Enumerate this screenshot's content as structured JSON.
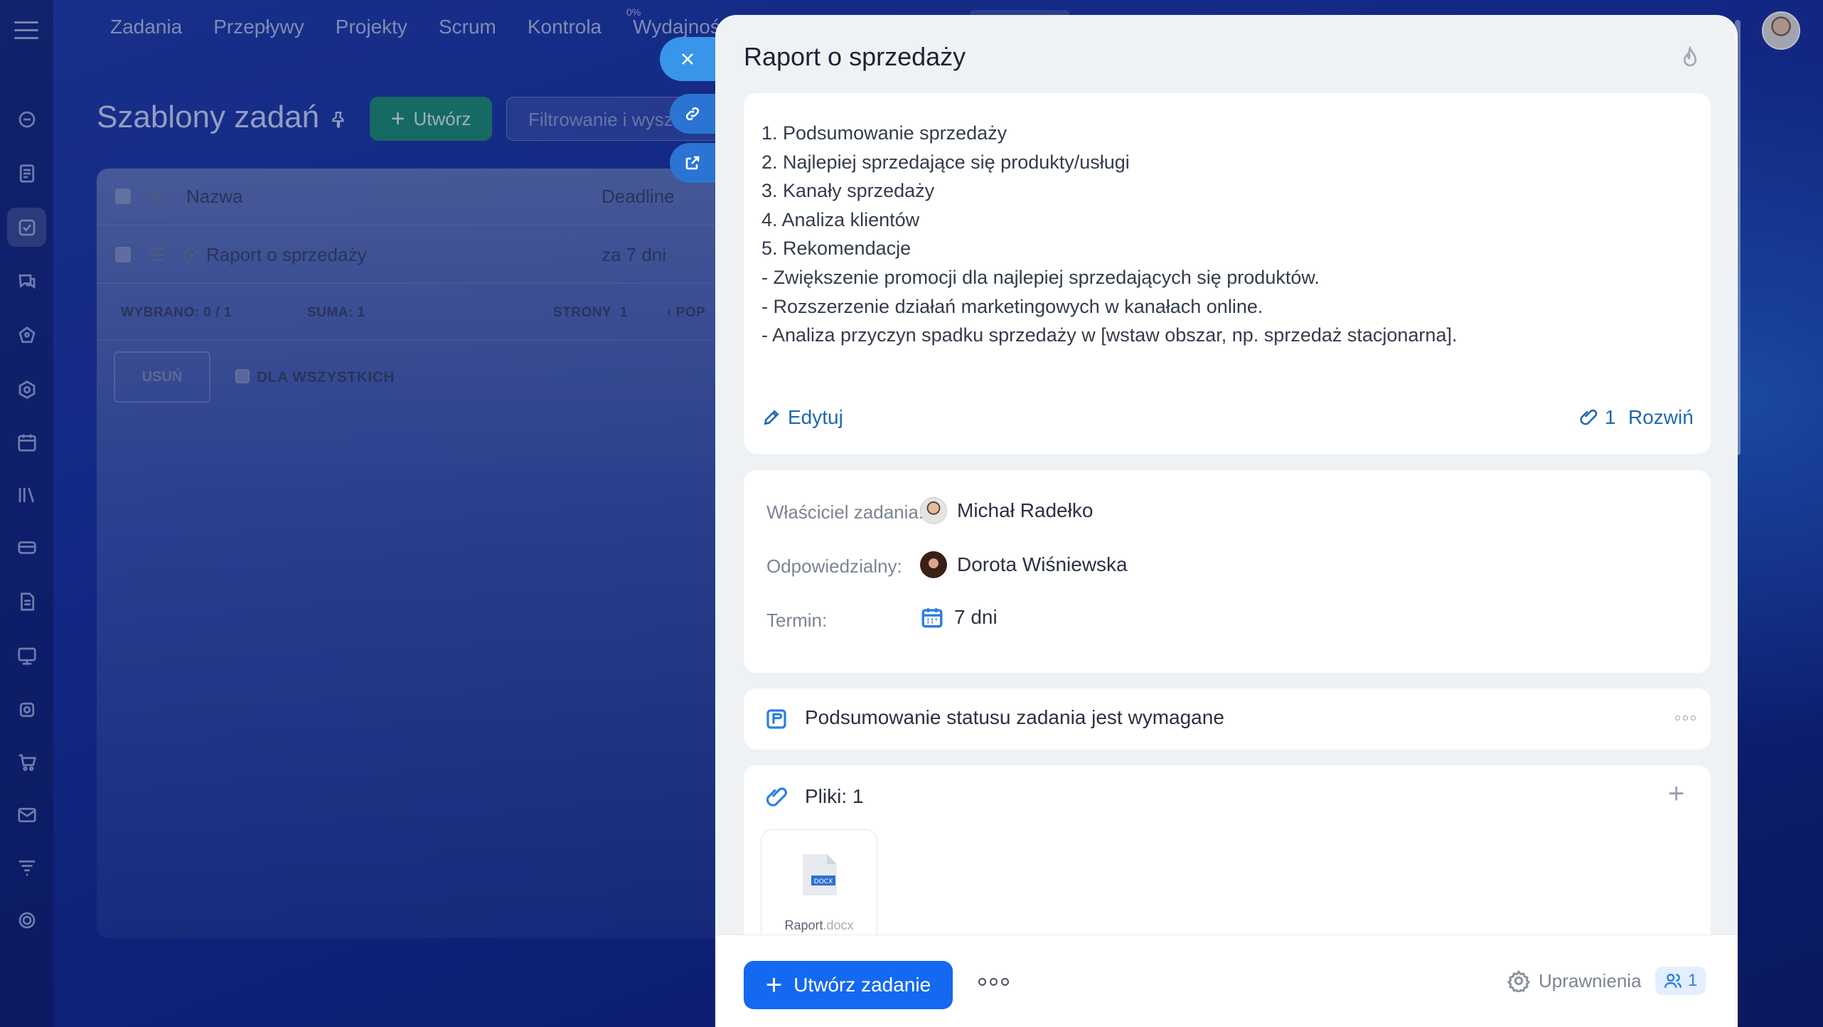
{
  "background": {
    "topnav": [
      "Zadania",
      "Przepływy",
      "Projekty",
      "Scrum",
      "Kontrola",
      "Wydajność"
    ],
    "topnav_percent": "0%",
    "page_title": "Szablony zadań",
    "create_label": "Utwórz",
    "filter_placeholder": "Filtrowanie i wyszukiwanie",
    "grid": {
      "col_name": "Nazwa",
      "col_deadline": "Deadline",
      "row_name": "Raport o sprzedaży",
      "row_deadline": "za 7 dni",
      "selected_label": "WYBRANO:",
      "selected_value": "0 / 1",
      "total_label": "SUMA:",
      "total_value": "1",
      "pages_label": "STRONY",
      "pages_value": "1",
      "prev_label": "POP",
      "delete_label": "USUŃ",
      "for_all_label": "DLA WSZYSTKICH"
    },
    "rail_icons": [
      "feed-icon",
      "documents-icon",
      "tasks-icon",
      "chat-icon",
      "crm-icon",
      "hexagon-icon",
      "calendar-icon",
      "library-icon",
      "card-icon",
      "file-icon",
      "contact-center-icon",
      "robot-icon",
      "cart-icon",
      "mail-icon",
      "filter-icon",
      "target-icon"
    ]
  },
  "slider": {
    "title": "Raport o sprzedaży",
    "description": [
      "1. Podsumowanie sprzedaży",
      "2. Najlepiej sprzedające się produkty/usługi",
      "3. Kanały sprzedaży",
      "4. Analiza klientów",
      "5. Rekomendacje",
      "- Zwiększenie promocji dla najlepiej sprzedających się produktów.",
      "- Rozszerzenie działań marketingowych w kanałach online.",
      "- Analiza przyczyn spadku sprzedaży w [wstaw obszar, np. sprzedaż stacjonarna]."
    ],
    "edit_label": "Edytuj",
    "attachments_count": "1",
    "expand_label": "Rozwiń",
    "owner_label": "Właściciel zadania:",
    "owner_value": "Michał Radełko",
    "responsible_label": "Odpowiedzialny:",
    "responsible_value": "Dorota Wiśniewska",
    "deadline_label": "Termin:",
    "deadline_value": "7 dni",
    "status_summary": "Podsumowanie statusu zadania jest wymagane",
    "files_label": "Pliki: 1",
    "file": {
      "name": "Raport",
      "ext": ".docx",
      "badge": "DOCX"
    },
    "create_task_label": "Utwórz zadanie",
    "permissions_label": "Uprawnienia",
    "permissions_count": "1"
  },
  "colors": {
    "accent": "#1469f0",
    "link": "#2067b0",
    "create_green": "#1c8a72",
    "side_button": "#2b8ae6"
  }
}
